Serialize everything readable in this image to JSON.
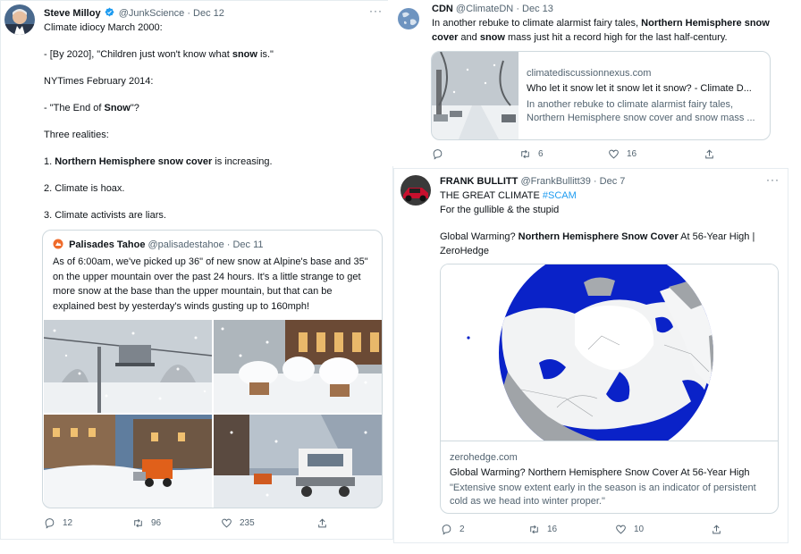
{
  "tweets": {
    "milloy": {
      "name": "Steve Milloy",
      "handle": "@JunkScience",
      "sep": "·",
      "date": "Dec 12",
      "more": "···",
      "lines": [
        "Climate idiocy March 2000:",
        "",
        "- [By 2020], \"Children just won't know what ",
        "",
        "NYTimes February 2014:",
        "",
        "- \"The End of ",
        "",
        "Three realities:",
        "",
        "1. ",
        "",
        "2. Climate is hoax.",
        "",
        "3. Climate activists are liars."
      ],
      "line3_bold": "snow",
      "line3_tail": " is.\"",
      "line7_bold": "Snow",
      "line7_tail": "\"?",
      "line11_bold": "Northern Hemisphere snow cover",
      "line11_tail": " is increasing.",
      "quote": {
        "name": "Palisades Tahoe",
        "handle": "@palisadestahoe",
        "sep": "·",
        "date": "Dec 11",
        "text": "As of 6:00am, we've picked up 36\" of new snow at Alpine's base and 35\" on the upper mountain over the past 24 hours. It's a little strange to get more snow at the base than the upper mountain, but that can be explained best by yesterday's winds gusting up to 160mph!"
      },
      "replies": "12",
      "retweets": "96",
      "likes": "235"
    },
    "cdn": {
      "name": "CDN",
      "handle": "@ClimateDN",
      "sep": "·",
      "date": "Dec 13",
      "text_pre": "In another rebuke to climate alarmist fairy tales, ",
      "text_b1": "Northern Hemisphere snow cover",
      "text_mid": " and ",
      "text_b2": "snow",
      "text_post": " mass just hit a record high for the last half-century.",
      "link": {
        "domain": "climatediscussionnexus.com",
        "title": "Who let it snow let it snow let it snow? - Climate D...",
        "desc": "In another rebuke to climate alarmist fairy tales, Northern Hemisphere snow cover and snow mass ..."
      },
      "retweets": "6",
      "likes": "16"
    },
    "bullitt": {
      "name": "FRANK BULLITT",
      "handle": "@FrankBullitt39",
      "sep": "·",
      "date": "Dec 7",
      "more": "···",
      "line1": "THE GREAT CLIMATE ",
      "hashtag": "#SCAM",
      "line2": "For the gullible & the stupid",
      "head_pre": "Global Warming? ",
      "head_bold": "Northern Hemisphere Snow Cover",
      "head_post": " At 56-Year High | ZeroHedge",
      "link": {
        "domain": "zerohedge.com",
        "title": "Global Warming? Northern Hemisphere Snow Cover At 56-Year High",
        "desc": "\"Extensive snow extent early in the season is an indicator of persistent cold as we head into winter proper.\""
      },
      "replies": "2",
      "retweets": "16",
      "likes": "10"
    }
  },
  "colors": {
    "link_blue": "#1d9bf0",
    "verified_blue": "#1d9bf0",
    "ocean_blue": "#0a22c8",
    "text_gray": "#536471"
  },
  "icons": [
    "verified-badge-icon",
    "reply-icon",
    "retweet-icon",
    "like-icon",
    "share-icon",
    "more-icon"
  ]
}
